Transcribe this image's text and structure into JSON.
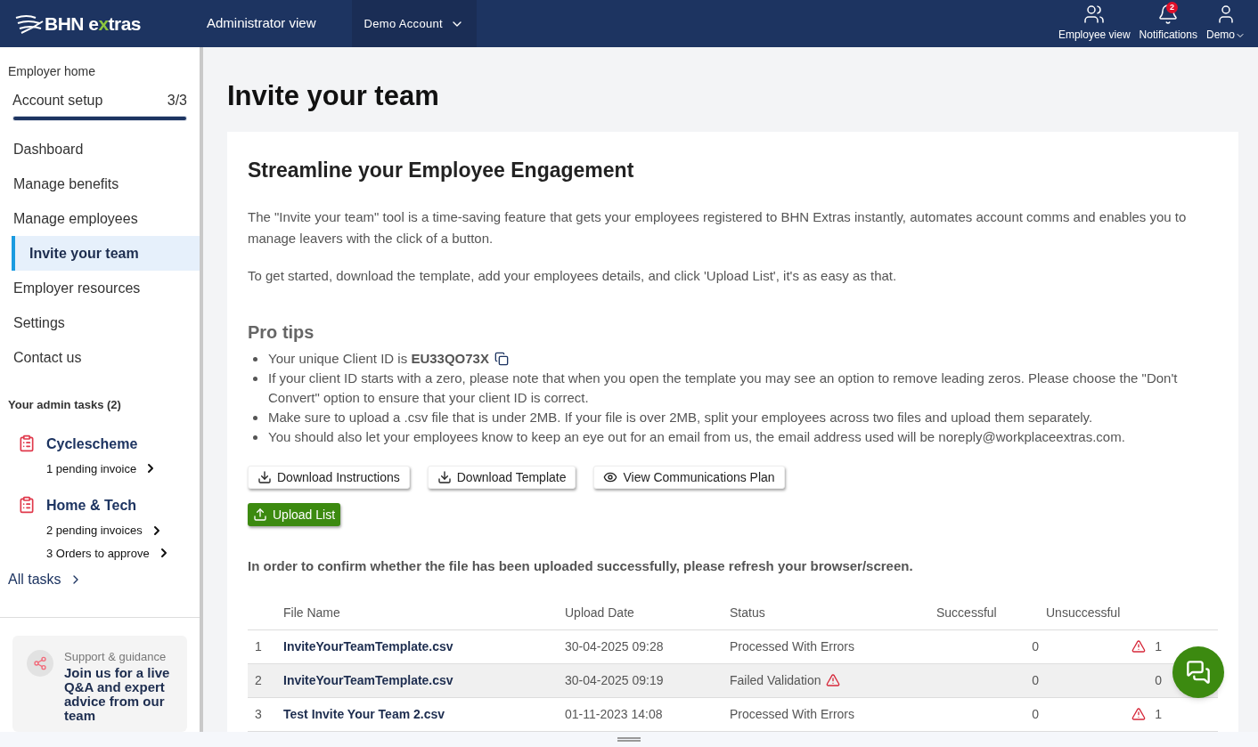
{
  "header": {
    "logo_parts": [
      "BHN e",
      "x",
      "tras"
    ],
    "view_label": "Administrator view",
    "account_menu": "Demo Account",
    "actions": [
      {
        "kind": "employee",
        "label": "Employee view"
      },
      {
        "kind": "notifications",
        "label": "Notifications",
        "badge": "2"
      },
      {
        "kind": "user",
        "label": "Demo"
      }
    ]
  },
  "sidebar": {
    "home": "Employer home",
    "setup": {
      "label": "Account setup",
      "count": "3/3",
      "level": 1
    },
    "items": [
      {
        "label": "Dashboard",
        "selected": false
      },
      {
        "label": "Manage benefits",
        "selected": false
      },
      {
        "label": "Manage employees",
        "selected": false
      },
      {
        "label": "Invite your team",
        "selected": true
      },
      {
        "label": "Employer resources",
        "selected": false
      },
      {
        "label": "Settings",
        "selected": false
      },
      {
        "label": "Contact us",
        "selected": false
      }
    ],
    "tasks_title": "Your admin tasks (2)",
    "tasks": [
      {
        "name": "Cyclescheme",
        "links": [
          "1 pending invoice"
        ]
      },
      {
        "name": "Home & Tech",
        "links": [
          "2 pending invoices",
          "3 Orders to approve"
        ]
      }
    ],
    "all_tasks": "All tasks",
    "support": {
      "label": "Support & guidance",
      "title": "Join us for a live Q&A and expert advice from our team"
    }
  },
  "page": {
    "title": "Invite your team",
    "card_title": "Streamline your Employee Engagement",
    "paragraphs": [
      "The \"Invite your team\" tool is a time-saving feature that gets your employees registered to BHN Extras instantly, automates account comms and enables you to manage leavers with the click of a button.",
      "To get started, download the template, add your employees details, and click 'Upload List', it's as easy as that."
    ],
    "tips_title": "Pro tips",
    "tips": [
      {
        "text": "Your unique Client ID is **EU33QO73X**",
        "copy": true
      },
      {
        "text": "If your client ID starts with a zero, please note that when you open the template you may see an option to remove leading zeros. Please choose the \"Don't Convert\" option to ensure that your client ID is correct.",
        "copy": false
      },
      {
        "text": "Make sure to upload a .csv file that is under 2MB. If your file is over 2MB, split your employees across two files and upload them separately.",
        "copy": false
      },
      {
        "text": "You should also let your employees know to keep an eye out for an email from us, the email address used will be noreply@workplaceextras.com.",
        "copy": false
      }
    ],
    "buttons": [
      {
        "kind": "download",
        "label": "Download Instructions"
      },
      {
        "kind": "download",
        "label": "Download Template"
      },
      {
        "kind": "view",
        "label": "View Communications Plan"
      }
    ],
    "upload_button": "Upload List",
    "notice": "In order to confirm whether the file has been uploaded successfully, please refresh your browser/screen.",
    "table": {
      "columns": [
        "File Name",
        "Upload Date",
        "Status",
        "Successful",
        "Unsuccessful"
      ],
      "rows": [
        {
          "index": "1",
          "file": "InviteYourTeamTemplate.csv",
          "date": "30-04-2025 09:28",
          "status": "Processed With Errors",
          "status_warning": false,
          "successful": "0",
          "unsuccessful": "1",
          "unsuccessful_warning": true,
          "highlighted": false
        },
        {
          "index": "2",
          "file": "InviteYourTeamTemplate.csv",
          "date": "30-04-2025 09:19",
          "status": "Failed Validation",
          "status_warning": true,
          "successful": "0",
          "unsuccessful": "0",
          "unsuccessful_warning": false,
          "highlighted": true
        },
        {
          "index": "3",
          "file": "Test Invite Your Team 2.csv",
          "date": "01-11-2023 14:08",
          "status": "Processed With Errors",
          "status_warning": false,
          "successful": "0",
          "unsuccessful": "1",
          "unsuccessful_warning": true,
          "highlighted": false
        }
      ]
    }
  }
}
